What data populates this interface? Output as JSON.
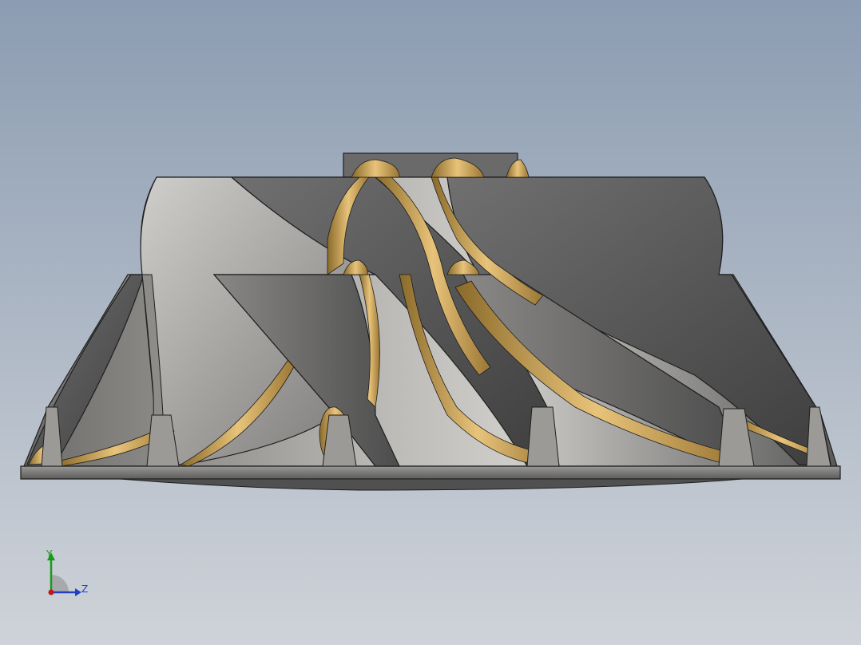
{
  "viewport": {
    "background_top": "#8c9cb2",
    "background_bottom": "#cfd3d9"
  },
  "model": {
    "part": "impeller",
    "colors": {
      "blade_dark": "#4a4a4a",
      "blade_mid": "#6e6e6e",
      "blade_light": "#c8c6c2",
      "fillet": "#d3aa62",
      "edge": "#1e1e1e"
    }
  },
  "triad": {
    "y_label": "Y",
    "z_label": "Z",
    "y_color": "#1a9a1a",
    "z_color": "#2040c0",
    "x_color": "#c01818"
  }
}
